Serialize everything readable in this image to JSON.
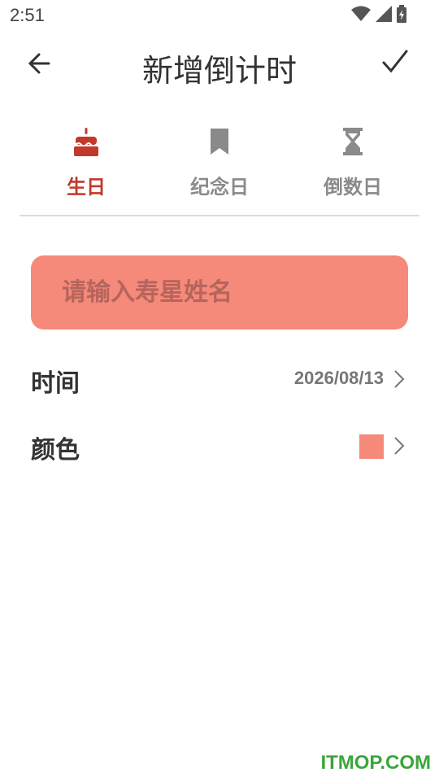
{
  "status_bar": {
    "time": "2:51"
  },
  "toolbar": {
    "title": "新增倒计时"
  },
  "tabs": [
    {
      "label": "生日",
      "icon": "cake-icon",
      "active": true
    },
    {
      "label": "纪念日",
      "icon": "bookmark-icon",
      "active": false
    },
    {
      "label": "倒数日",
      "icon": "hourglass-icon",
      "active": false
    }
  ],
  "name_input": {
    "placeholder": "请输入寿星姓名",
    "value": ""
  },
  "time_row": {
    "label": "时间",
    "value": "2026/08/13"
  },
  "color_row": {
    "label": "颜色",
    "swatch_color": "#f5897a"
  },
  "watermark": {
    "text": "ITMOP.COM",
    "color": "#3aa63a"
  },
  "colors": {
    "accent": "#c0392b",
    "inactive": "#8a8a8a",
    "input_bg": "#f5897a"
  }
}
